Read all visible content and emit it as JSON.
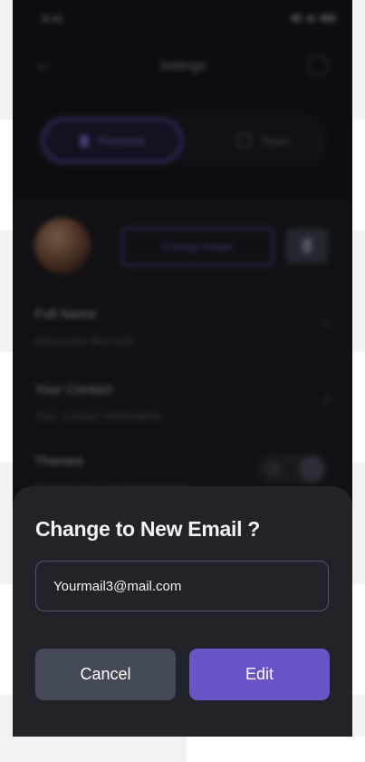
{
  "background_screen": {
    "status_time": "9:41",
    "title": "Settings",
    "tabs": [
      {
        "label": "Personal",
        "active": true
      },
      {
        "label": "Team",
        "active": false
      }
    ],
    "change_avatar_label": "Change Avatar",
    "rows": [
      {
        "title": "Full Name",
        "subtitle": "Alexandra Bernard"
      },
      {
        "title": "Your Contact",
        "subtitle": "Your contact information"
      },
      {
        "title": "Themes",
        "subtitle": "Choose your preferred theme"
      }
    ]
  },
  "dialog": {
    "title": "Change to New Email ?",
    "email_value": "Yourmail3@mail.com",
    "cancel_label": "Cancel",
    "edit_label": "Edit"
  },
  "colors": {
    "sheet_bg": "#222328",
    "cancel_bg": "#434957",
    "edit_bg": "#6a54c8",
    "accent": "#5b48b0"
  }
}
